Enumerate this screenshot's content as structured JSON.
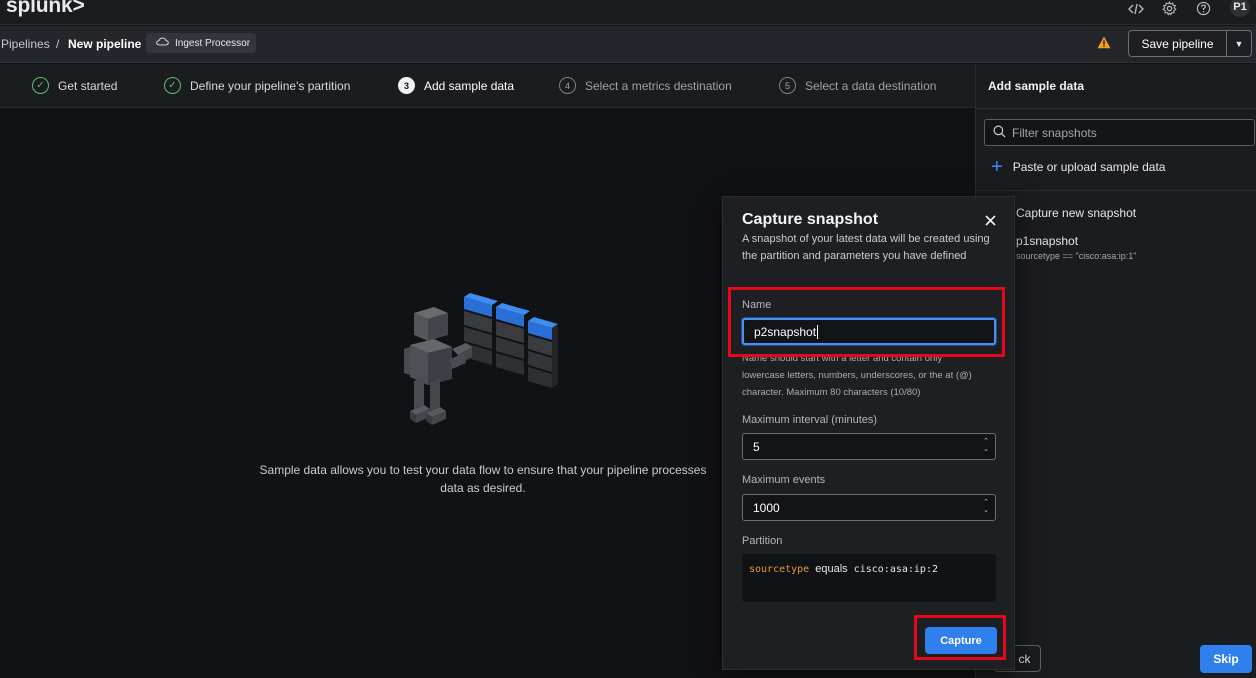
{
  "topbar": {
    "logo": "splunk>",
    "avatar": "P1"
  },
  "breadcrumb": {
    "root": "Pipelines",
    "separator": "/",
    "current": "New pipeline",
    "chip": "Ingest Processor"
  },
  "actions": {
    "save": "Save pipeline"
  },
  "steps": [
    {
      "label": "Get started",
      "state": "done"
    },
    {
      "label": "Define your pipeline's partition",
      "state": "done"
    },
    {
      "num": "3",
      "label": "Add sample data",
      "state": "active"
    },
    {
      "num": "4",
      "label": "Select a metrics destination",
      "state": "pending"
    },
    {
      "num": "5",
      "label": "Select a data destination",
      "state": "pending"
    }
  ],
  "empty_state": {
    "text": "Sample data allows you to test your data flow to ensure that your pipeline processes data as desired."
  },
  "right_panel": {
    "title": "Add sample data",
    "filter_placeholder": "Filter snapshots",
    "paste": "Paste or upload sample data",
    "capture_new": "Capture new snapshot",
    "snapshot_name": "p1snapshot",
    "snapshot_meta": "sourcetype == \"cisco:asa:ip:1\"",
    "back": "ck",
    "skip": "Skip"
  },
  "modal": {
    "title": "Capture snapshot",
    "description": "A snapshot of your latest data will be created using the partition and parameters you have defined",
    "name_label": "Name",
    "name_value": "p2snapshot",
    "name_help": "Name should start with a letter and contain only lowercase letters, numbers, underscores, or the at (@) character. Maximum 80 characters (10/80)",
    "interval_label": "Maximum interval (minutes)",
    "interval_value": "5",
    "events_label": "Maximum events",
    "events_value": "1000",
    "partition_label": "Partition",
    "partition_key": "sourcetype",
    "partition_op": "equals",
    "partition_value": "cisco:asa:ip:2",
    "capture": "Capture"
  },
  "colors": {
    "accent": "#2f80ed",
    "success": "#57c267",
    "warning": "#f0a020",
    "highlight": "#e3081b"
  },
  "icons": [
    "code-icon",
    "gear-icon",
    "help-icon",
    "cloud-icon",
    "warning-icon",
    "check-circle-icon",
    "search-icon",
    "plus-icon",
    "close-icon"
  ]
}
